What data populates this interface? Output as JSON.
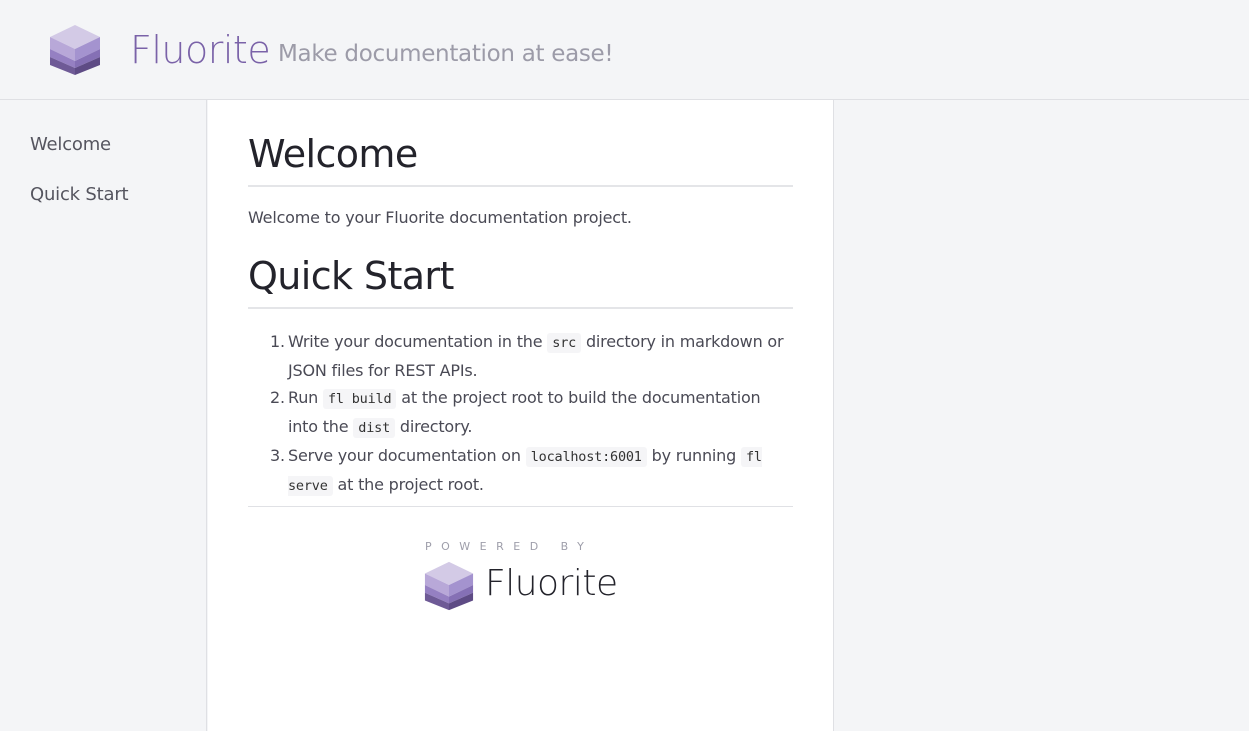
{
  "header": {
    "brand": "Fluorite",
    "tagline": "Make documentation at ease!",
    "logo_icon": "fluorite-cube-icon"
  },
  "sidebar": {
    "items": [
      {
        "label": "Welcome"
      },
      {
        "label": "Quick Start"
      }
    ]
  },
  "main": {
    "welcome_title": "Welcome",
    "welcome_text": "Welcome to your Fluorite documentation project.",
    "quickstart_title": "Quick Start",
    "steps": [
      {
        "num": "1.",
        "pre": "Write your documentation in the ",
        "code1": "src",
        "post": " directory in markdown or JSON files for REST APIs."
      },
      {
        "num": "2.",
        "pre": "Run ",
        "code1": "fl build",
        "mid": " at the project root to build the documentation into the ",
        "code2": "dist",
        "post": " directory."
      },
      {
        "num": "3.",
        "pre": "Serve your documentation on ",
        "code1": "localhost:6001",
        "mid": " by running ",
        "code2": "fl serve",
        "post": " at the project root."
      }
    ]
  },
  "footer": {
    "powered_by": "POWERED BY",
    "brand": "Fluorite"
  },
  "colors": {
    "accent": "#7a62a8",
    "cube_top": "#c4b8dc",
    "cube_mid": "#9a85c3",
    "cube_bottom": "#6a548f"
  }
}
